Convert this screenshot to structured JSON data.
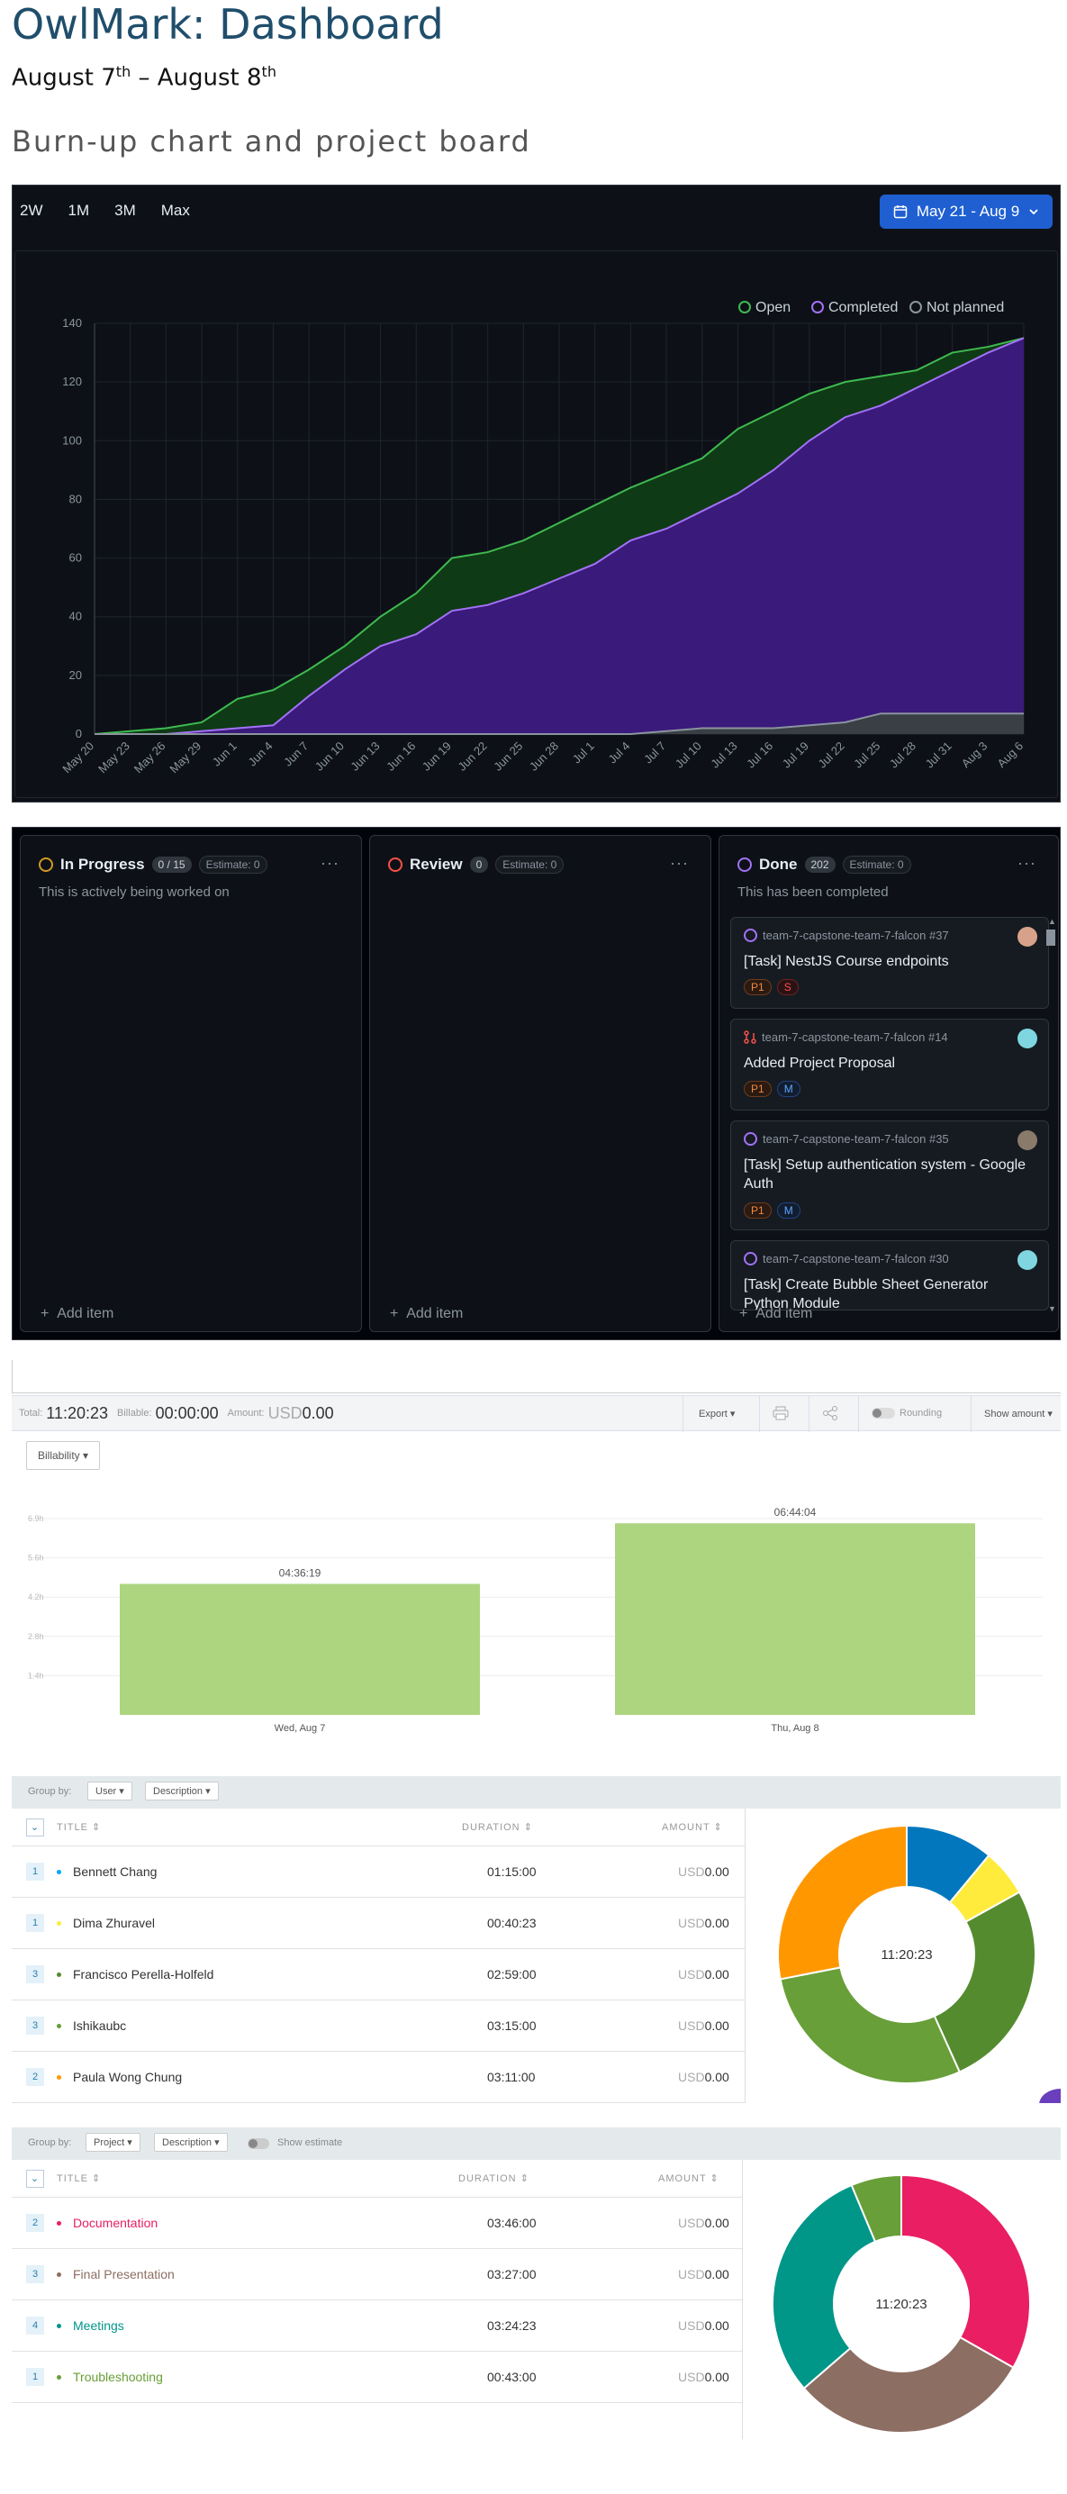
{
  "page": {
    "title": "OwlMark: Dashboard",
    "date_start": "August 7",
    "date_start_sup": "th",
    "date_sep": " – ",
    "date_end": "August 8",
    "date_end_sup": "th",
    "section_title": "Burn-up chart and project board"
  },
  "burnup": {
    "ranges": [
      "2W",
      "1M",
      "3M",
      "Max"
    ],
    "date_button": "May 21 - Aug 9",
    "colors": {
      "open": "#3fb950",
      "completed": "#a371f7",
      "not_planned": "#8b949e"
    },
    "legend": [
      "Open",
      "Completed",
      "Not planned"
    ],
    "chart_data": {
      "type": "area",
      "x": [
        "May 20",
        "May 23",
        "May 26",
        "May 29",
        "Jun 1",
        "Jun 4",
        "Jun 7",
        "Jun 10",
        "Jun 13",
        "Jun 16",
        "Jun 19",
        "Jun 22",
        "Jun 25",
        "Jun 28",
        "Jul 1",
        "Jul 4",
        "Jul 7",
        "Jul 10",
        "Jul 13",
        "Jul 16",
        "Jul 19",
        "Jul 22",
        "Jul 25",
        "Jul 28",
        "Jul 31",
        "Aug 3",
        "Aug 6"
      ],
      "series": [
        {
          "name": "Open",
          "values": [
            0,
            1,
            2,
            4,
            12,
            15,
            22,
            30,
            40,
            48,
            60,
            62,
            66,
            72,
            78,
            84,
            89,
            94,
            104,
            110,
            116,
            120,
            122,
            124,
            130,
            132,
            135
          ]
        },
        {
          "name": "Completed",
          "values": [
            0,
            0,
            0,
            1,
            2,
            3,
            13,
            22,
            30,
            34,
            42,
            44,
            48,
            53,
            58,
            66,
            70,
            76,
            82,
            90,
            100,
            108,
            112,
            118,
            124,
            130,
            135
          ]
        },
        {
          "name": "Not planned",
          "values": [
            0,
            0,
            0,
            0,
            0,
            0,
            0,
            0,
            0,
            0,
            0,
            0,
            0,
            0,
            0,
            0,
            1,
            2,
            2,
            2,
            3,
            4,
            7,
            7,
            7,
            7,
            7
          ]
        }
      ],
      "yticks": [
        0,
        20,
        40,
        60,
        80,
        100,
        120,
        140
      ],
      "ylim": [
        0,
        140
      ],
      "grid": true,
      "legend_position": "top-right"
    }
  },
  "board": {
    "columns": [
      {
        "name": "In Progress",
        "count": "0 / 15",
        "estimate": "Estimate: 0",
        "desc": "This is actively being worked on",
        "add": "Add item",
        "color": "#d29922"
      },
      {
        "name": "Review",
        "count": "0",
        "estimate": "Estimate: 0",
        "desc": "",
        "add": "Add item",
        "color": "#f85149"
      },
      {
        "name": "Done",
        "count": "202",
        "estimate": "Estimate: 0",
        "desc": "This has been completed",
        "add": "Add item",
        "color": "#a371f7"
      }
    ],
    "cards": [
      {
        "repo": "team-7-capstone-team-7-falcon #37",
        "title": "[Task] NestJS Course endpoints",
        "tags": [
          "P1",
          "S"
        ]
      },
      {
        "repo": "team-7-capstone-team-7-falcon #14",
        "title": "Added Project Proposal",
        "tags": [
          "P1",
          "M"
        ]
      },
      {
        "repo": "team-7-capstone-team-7-falcon #35",
        "title": "[Task] Setup authentication system - Google Auth",
        "tags": [
          "P1",
          "M"
        ]
      },
      {
        "repo": "team-7-capstone-team-7-falcon #30",
        "title": "[Task] Create Bubble Sheet Generator Python Module",
        "tags": []
      }
    ],
    "more": "···",
    "plus": "+"
  },
  "tracking": {
    "total_label": "Total:",
    "total": "11:20:23",
    "billable_label": "Billable:",
    "billable": "00:00:00",
    "amount_label": "Amount:",
    "amount_cur": "USD",
    "amount": "0.00",
    "export": "Export ▾",
    "rounding": "Rounding",
    "show_amount": "Show amount ▾",
    "billability": "Billability ▾",
    "bar_chart": {
      "type": "bar",
      "categories": [
        "Wed, Aug 7",
        "Thu, Aug 8"
      ],
      "values": [
        4.605,
        6.734
      ],
      "labels": [
        "04:36:19",
        "06:44:04"
      ],
      "yticks": [
        "1.4h",
        "2.8h",
        "4.2h",
        "5.6h",
        "6.9h"
      ],
      "ylim": [
        0,
        6.9
      ],
      "color": "#add580"
    },
    "group1": {
      "group_by": "Group by:",
      "sel1": "User ▾",
      "sel2": "Description ▾",
      "col_title": "TITLE",
      "col_duration": "DURATION",
      "col_amount": "AMOUNT",
      "rows": [
        {
          "n": "1",
          "name": "Bennett Chang",
          "duration": "01:15:00",
          "cur": "USD",
          "amount": "0.00",
          "color": "#03a9f4"
        },
        {
          "n": "1",
          "name": "Dima Zhuravel",
          "duration": "00:40:23",
          "cur": "USD",
          "amount": "0.00",
          "color": "#ffeb3b"
        },
        {
          "n": "3",
          "name": "Francisco Perella-Holfeld",
          "duration": "02:59:00",
          "cur": "USD",
          "amount": "0.00",
          "color": "#558b2f"
        },
        {
          "n": "3",
          "name": "Ishikaubc",
          "duration": "03:15:00",
          "cur": "USD",
          "amount": "0.00",
          "color": "#689f38"
        },
        {
          "n": "2",
          "name": "Paula Wong Chung",
          "duration": "03:11:00",
          "cur": "USD",
          "amount": "0.00",
          "color": "#ff9800"
        }
      ],
      "donut_center": "11:20:23",
      "chart_data": {
        "type": "pie",
        "categories": [
          "Bennett Chang",
          "Dima Zhuravel",
          "Francisco Perella-Holfeld",
          "Ishikaubc",
          "Paula Wong Chung"
        ],
        "values": [
          75,
          40.38,
          179,
          195,
          191
        ],
        "colors": [
          "#0277bd",
          "#ffeb3b",
          "#558b2f",
          "#689f38",
          "#ff9800"
        ]
      }
    },
    "group2": {
      "group_by": "Group by:",
      "sel1": "Project ▾",
      "sel2": "Description ▾",
      "show_estimate": "Show estimate",
      "col_title": "TITLE",
      "col_duration": "DURATION",
      "col_amount": "AMOUNT",
      "rows": [
        {
          "n": "2",
          "name": "Documentation",
          "duration": "03:46:00",
          "cur": "USD",
          "amount": "0.00",
          "color": "#e91e63"
        },
        {
          "n": "3",
          "name": "Final Presentation",
          "duration": "03:27:00",
          "cur": "USD",
          "amount": "0.00",
          "color": "#8d6e63"
        },
        {
          "n": "4",
          "name": "Meetings",
          "duration": "03:24:23",
          "cur": "USD",
          "amount": "0.00",
          "color": "#009688"
        },
        {
          "n": "1",
          "name": "Troubleshooting",
          "duration": "00:43:00",
          "cur": "USD",
          "amount": "0.00",
          "color": "#689f38"
        }
      ],
      "donut_center": "11:20:23",
      "chart_data": {
        "type": "pie",
        "categories": [
          "Documentation",
          "Final Presentation",
          "Meetings",
          "Troubleshooting"
        ],
        "values": [
          226,
          207,
          204.38,
          43
        ],
        "colors": [
          "#e91e63",
          "#8d6e63",
          "#009688",
          "#689f38"
        ]
      }
    }
  }
}
